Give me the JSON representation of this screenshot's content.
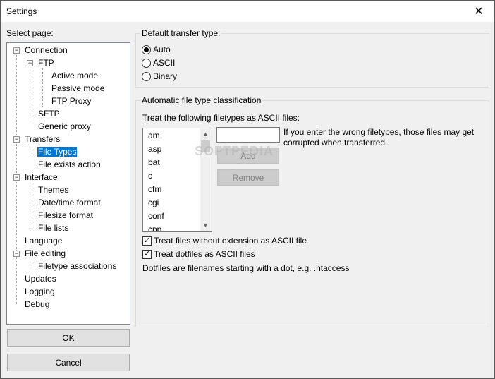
{
  "window": {
    "title": "Settings",
    "close_icon": "close-icon"
  },
  "select_page_label": "Select page:",
  "tree": [
    {
      "label": "Connection"
    },
    {
      "label": "FTP"
    },
    {
      "label": "Active mode"
    },
    {
      "label": "Passive mode"
    },
    {
      "label": "FTP Proxy"
    },
    {
      "label": "SFTP"
    },
    {
      "label": "Generic proxy"
    },
    {
      "label": "Transfers"
    },
    {
      "label": "File Types",
      "selected": true
    },
    {
      "label": "File exists action"
    },
    {
      "label": "Interface"
    },
    {
      "label": "Themes"
    },
    {
      "label": "Date/time format"
    },
    {
      "label": "Filesize format"
    },
    {
      "label": "File lists"
    },
    {
      "label": "Language"
    },
    {
      "label": "File editing"
    },
    {
      "label": "Filetype associations"
    },
    {
      "label": "Updates"
    },
    {
      "label": "Logging"
    },
    {
      "label": "Debug"
    }
  ],
  "buttons": {
    "ok": "OK",
    "cancel": "Cancel",
    "add": "Add",
    "remove": "Remove"
  },
  "transfer_type": {
    "title": "Default transfer type:",
    "options": [
      {
        "label": "Auto",
        "checked": true
      },
      {
        "label": "ASCII",
        "checked": false
      },
      {
        "label": "Binary",
        "checked": false
      }
    ]
  },
  "classification": {
    "title": "Automatic file type classification",
    "treat_label": "Treat the following filetypes as ASCII files:",
    "filetypes": [
      "am",
      "asp",
      "bat",
      "c",
      "cfm",
      "cgi",
      "conf",
      "cpp"
    ],
    "new_filetype_value": "",
    "warning": "If you enter the wrong filetypes, those files may get corrupted when transferred.",
    "check_no_extension": {
      "label": "Treat files without extension as ASCII file",
      "checked": true
    },
    "check_dotfiles": {
      "label": "Treat dotfiles as ASCII files",
      "checked": true
    },
    "dotfiles_note": "Dotfiles are filenames starting with a dot, e.g. .htaccess"
  },
  "watermark": "SOFTPEDIA"
}
